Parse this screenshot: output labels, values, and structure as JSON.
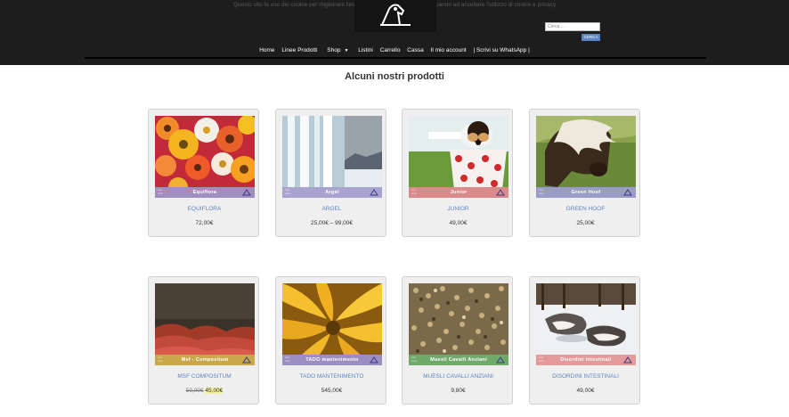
{
  "header": {
    "topline": "Questo sito fa uso dei cookie per migliorare l'esperienza di navigazione. Continuando ad accettare l'utilizzo di cookie e privacy",
    "search_placeholder": "Cerca ...",
    "search_button": "CERCA",
    "nav": [
      {
        "label": "Home"
      },
      {
        "label": "Linee Prodotti"
      },
      {
        "label": "Shop"
      },
      {
        "label": "Listini"
      },
      {
        "label": "Carrello"
      },
      {
        "label": "Cassa"
      },
      {
        "label": "Il mio account"
      },
      {
        "label": "| Scrivi su WhatsApp |"
      }
    ]
  },
  "main": {
    "title": "Alcuni nostri prodotti",
    "products": [
      {
        "name": "EQUIFLORA",
        "banner": "Equiflora",
        "price": "72,00€",
        "image": "orange-gerbera-flowers",
        "banner_color": "#9f8fc0"
      },
      {
        "name": "ARGEL",
        "banner": "Argel",
        "price": "25,00€ – 99,00€",
        "image": "frozen-waterfall",
        "banner_color": "#a9a3cf"
      },
      {
        "name": "JUNIOR",
        "banner": "Junior",
        "price": "49,00€",
        "image": "puppy-in-polka-dot-cup",
        "banner_color": "#d98a8a"
      },
      {
        "name": "GREEN HOOF",
        "banner": "Green Hoof",
        "price": "25,00€",
        "image": "white-maned-pony",
        "banner_color": "#9a9bc6"
      },
      {
        "name": "MSF COMPOSITUM",
        "banner": "Msf - Compositum",
        "price_old": "50,00€",
        "price_new": "45,00€",
        "image": "red-heather-field",
        "banner_color": "#c9a84a"
      },
      {
        "name": "TADO MANTENIMENTO",
        "banner": "TADO mantenimento",
        "price": "545,00€",
        "image": "yellow-flower-petals",
        "banner_color": "#9b8fc0"
      },
      {
        "name": "MUESLI CAVALLI ANZIANI",
        "banner": "Muesli Cavalli Anziani",
        "price": "9,80€",
        "image": "muesli-grain-mix",
        "banner_color": "#6faa6a"
      },
      {
        "name": "DISORDINI INTESTINALI",
        "banner": "Disordini intestinali",
        "price": "49,00€",
        "image": "husky-dogs-in-snow",
        "banner_color": "#e39a9a"
      }
    ]
  }
}
